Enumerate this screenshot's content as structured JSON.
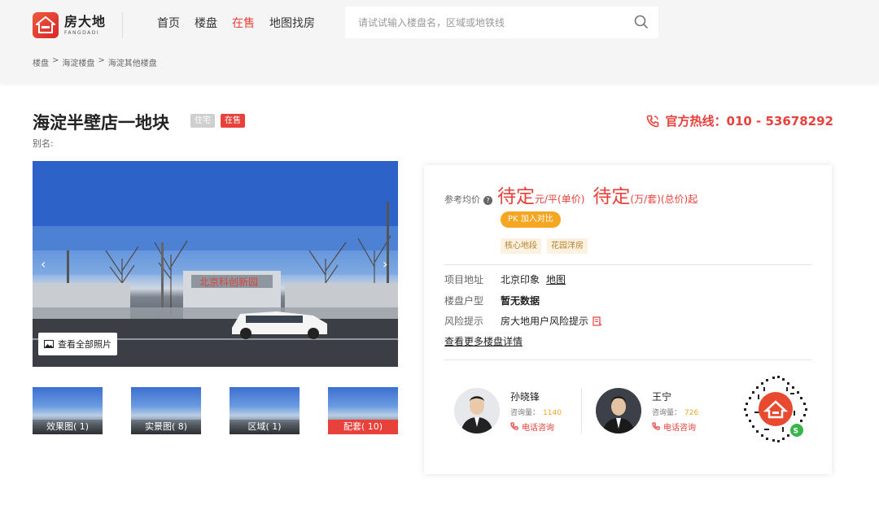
{
  "header": {
    "logo_cn": "房大地",
    "logo_en": "FANGDADI",
    "nav": [
      "首页",
      "楼盘",
      "在售",
      "地图找房"
    ],
    "nav_active_index": 2,
    "search_placeholder": "请试试输入楼盘名，区域或地铁线"
  },
  "breadcrumb": [
    "楼盘",
    ">",
    "海淀楼盘",
    ">",
    "海淀其他楼盘"
  ],
  "property": {
    "title": "海淀半壁店一地块",
    "tag_type": "住宅",
    "tag_status": "在售",
    "alias_label": "别名:",
    "hotline": "官方热线：010 - 53678292"
  },
  "photo": {
    "view_all": "查看全部照片",
    "sign_text": "北京科创新园"
  },
  "thumbnails": [
    {
      "label": "效果图( 1)"
    },
    {
      "label": "实景图( 8)"
    },
    {
      "label": "区域( 1)"
    },
    {
      "label": "配套( 10)"
    }
  ],
  "card": {
    "price_label": "参考均价",
    "help_icon": "?",
    "price1": "待定",
    "unit1": "元/平(单价)",
    "price2": "待定",
    "unit2": "(万/套)(总价)起",
    "pk_button": "PK 加入对比",
    "feature_tags": [
      "核心地段",
      "花园洋房"
    ],
    "rows": [
      {
        "label": "项目地址",
        "value": "北京印象",
        "link": "地图"
      },
      {
        "label": "楼盘户型",
        "value": "暂无数据"
      },
      {
        "label": "风险提示",
        "value": "房大地用户风险提示"
      }
    ],
    "more_link": "查看更多楼盘详情",
    "agents": [
      {
        "name": "孙晓锋",
        "count_label": "咨询量：",
        "count": "1140",
        "call": "电话咨询"
      },
      {
        "name": "王宁",
        "count_label": "咨询量：",
        "count": "726",
        "call": "电话咨询"
      }
    ]
  },
  "colors": {
    "accent": "#e8403a",
    "orange": "#f5a623",
    "tag_bg": "#fdf2e1"
  }
}
